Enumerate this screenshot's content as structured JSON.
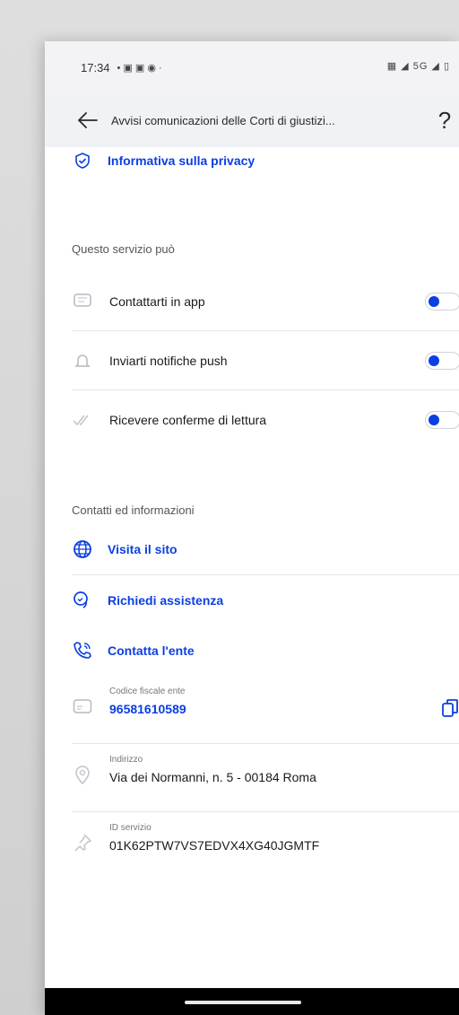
{
  "status_bar": {
    "time": "17:34",
    "left_icons": "• ▣ ▣ ◉ ·",
    "right_icons": "▦ ◢ 5G ◢ ▯"
  },
  "app_bar": {
    "title": "Avvisi comunicazioni delle Corti di giustizi...",
    "help_label": "?"
  },
  "privacy_link": {
    "label": "Informativa sulla privacy",
    "icon": "shield-check-icon"
  },
  "permissions": {
    "title": "Questo servizio può",
    "items": [
      {
        "label": "Contattarti in app",
        "icon": "message-icon",
        "enabled": true
      },
      {
        "label": "Inviarti notifiche push",
        "icon": "bell-icon",
        "enabled": true
      },
      {
        "label": "Ricevere conferme di lettura",
        "icon": "double-check-icon",
        "enabled": true
      }
    ]
  },
  "contacts": {
    "title": "Contatti ed informazioni",
    "links": [
      {
        "label": "Visita il sito",
        "icon": "globe-icon"
      },
      {
        "label": "Richiedi assistenza",
        "icon": "chat-icon"
      },
      {
        "label": "Contatta l'ente",
        "icon": "phone-icon"
      }
    ],
    "info": [
      {
        "label": "Codice fiscale ente",
        "value": "96581610589",
        "icon": "id-card-icon",
        "is_link": true,
        "copyable": true
      },
      {
        "label": "Indirizzo",
        "value": "Via dei Normanni, n. 5 - 00184 Roma",
        "icon": "pin-icon",
        "is_link": false
      },
      {
        "label": "ID servizio",
        "value": "01K62PTW7VS7EDVX4XG40JGMTF",
        "icon": "pushpin-icon",
        "is_link": false
      }
    ]
  },
  "colors": {
    "accent": "#0b3ee3",
    "appbar_bg": "#f1f2f6",
    "divider": "#e4e6ea"
  }
}
